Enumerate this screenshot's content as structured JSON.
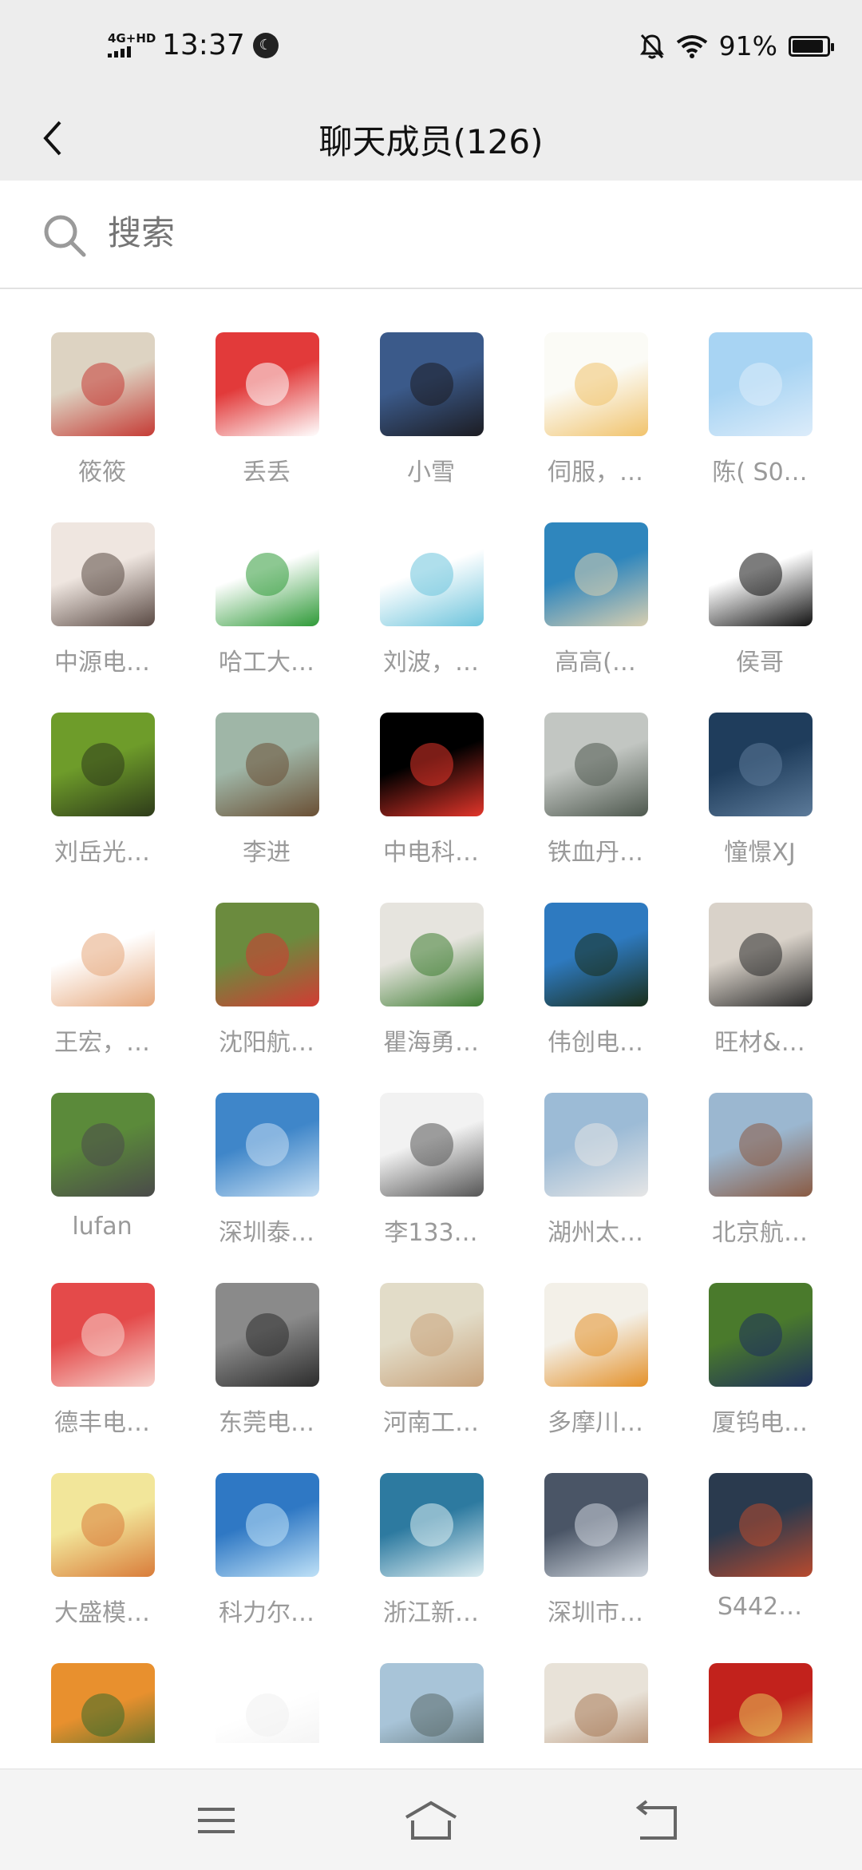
{
  "status_bar": {
    "network": "4G+HD",
    "time": "13:37",
    "battery": "91%",
    "battery_level": 0.91
  },
  "header": {
    "title": "聊天成员(126)",
    "back_icon": "chevron-left-icon"
  },
  "search": {
    "placeholder": "搜索",
    "icon": "search-icon"
  },
  "members": [
    {
      "name": "筱筱",
      "colors": [
        "#ddd3c2",
        "#c53b35"
      ]
    },
    {
      "name": "丢丢",
      "colors": [
        "#e23a3a",
        "#ffffff"
      ]
    },
    {
      "name": "小雪",
      "colors": [
        "#3b5a8a",
        "#1c1c22"
      ]
    },
    {
      "name": "伺服，…",
      "colors": [
        "#fbfbf6",
        "#f1c36c"
      ]
    },
    {
      "name": "陈( S0…",
      "colors": [
        "#a8d4f3",
        "#dcecfa"
      ]
    },
    {
      "name": "中源电…",
      "colors": [
        "#efe6e0",
        "#5a4a44"
      ]
    },
    {
      "name": "哈工大…",
      "colors": [
        "#ffffff",
        "#2f9a38"
      ]
    },
    {
      "name": "刘波，…",
      "colors": [
        "#ffffff",
        "#6dc4dc"
      ]
    },
    {
      "name": "高高(…",
      "colors": [
        "#2f86bd",
        "#d8cfb1"
      ]
    },
    {
      "name": "侯哥",
      "colors": [
        "#ffffff",
        "#111111"
      ]
    },
    {
      "name": "刘岳光…",
      "colors": [
        "#6e9c2a",
        "#2e3b1a"
      ]
    },
    {
      "name": "李进",
      "colors": [
        "#9fb6a7",
        "#6a4f34"
      ]
    },
    {
      "name": "中电科…",
      "colors": [
        "#000000",
        "#e2352a"
      ]
    },
    {
      "name": "铁血丹…",
      "colors": [
        "#c2c6c2",
        "#4e584e"
      ]
    },
    {
      "name": "憧憬XJ",
      "colors": [
        "#1f3d5c",
        "#5c7a99"
      ]
    },
    {
      "name": "王宏，…",
      "colors": [
        "#ffffff",
        "#e6a87c"
      ]
    },
    {
      "name": "沈阳航…",
      "colors": [
        "#6b8b3e",
        "#d23b33"
      ]
    },
    {
      "name": "瞿海勇…",
      "colors": [
        "#e6e4de",
        "#3e7d32"
      ]
    },
    {
      "name": "伟创电…",
      "colors": [
        "#2e7ac0",
        "#1a2e1a"
      ]
    },
    {
      "name": "旺材&…",
      "colors": [
        "#d9d2c9",
        "#2a2a2a"
      ]
    },
    {
      "name": "lufan",
      "colors": [
        "#5b8a3a",
        "#4a4a4a"
      ]
    },
    {
      "name": "深圳泰…",
      "colors": [
        "#3f86c9",
        "#c4ddf2"
      ]
    },
    {
      "name": "李133…",
      "colors": [
        "#f2f2f2",
        "#555555"
      ]
    },
    {
      "name": "湖州太…",
      "colors": [
        "#9cbbd6",
        "#e6e6e6"
      ]
    },
    {
      "name": "北京航…",
      "colors": [
        "#9bb7d0",
        "#8a5a42"
      ]
    },
    {
      "name": "德丰电…",
      "colors": [
        "#e44a4a",
        "#f7d2cc"
      ]
    },
    {
      "name": "东莞电…",
      "colors": [
        "#8a8a8a",
        "#2c2c2c"
      ]
    },
    {
      "name": "河南工…",
      "colors": [
        "#e2dcc8",
        "#c8a27a"
      ]
    },
    {
      "name": "多摩川…",
      "colors": [
        "#f3f0e8",
        "#e4912a"
      ]
    },
    {
      "name": "厦钨电…",
      "colors": [
        "#4a7a2c",
        "#1e2f5c"
      ]
    },
    {
      "name": "大盛模…",
      "colors": [
        "#f2e69a",
        "#d97c3a"
      ]
    },
    {
      "name": "科力尔…",
      "colors": [
        "#2f78c4",
        "#bfe1f7"
      ]
    },
    {
      "name": "浙江新…",
      "colors": [
        "#2d7aa0",
        "#ddeef2"
      ]
    },
    {
      "name": "深圳市…",
      "colors": [
        "#4a5566",
        "#cfd6de"
      ]
    },
    {
      "name": "S442…",
      "colors": [
        "#2a3a4e",
        "#b84a2e"
      ]
    },
    {
      "name": "",
      "colors": [
        "#e8902e",
        "#3a6a2a"
      ]
    },
    {
      "name": "",
      "colors": [
        "#ffffff",
        "#f0f0f0"
      ]
    },
    {
      "name": "",
      "colors": [
        "#a8c4d8",
        "#5a6a6a"
      ]
    },
    {
      "name": "",
      "colors": [
        "#e8e2d8",
        "#a87a58"
      ]
    },
    {
      "name": "",
      "colors": [
        "#c2221c",
        "#e8c25a"
      ]
    }
  ],
  "nav_bar": {
    "menu_icon": "menu-icon",
    "home_icon": "home-icon",
    "back_icon": "back-icon"
  }
}
